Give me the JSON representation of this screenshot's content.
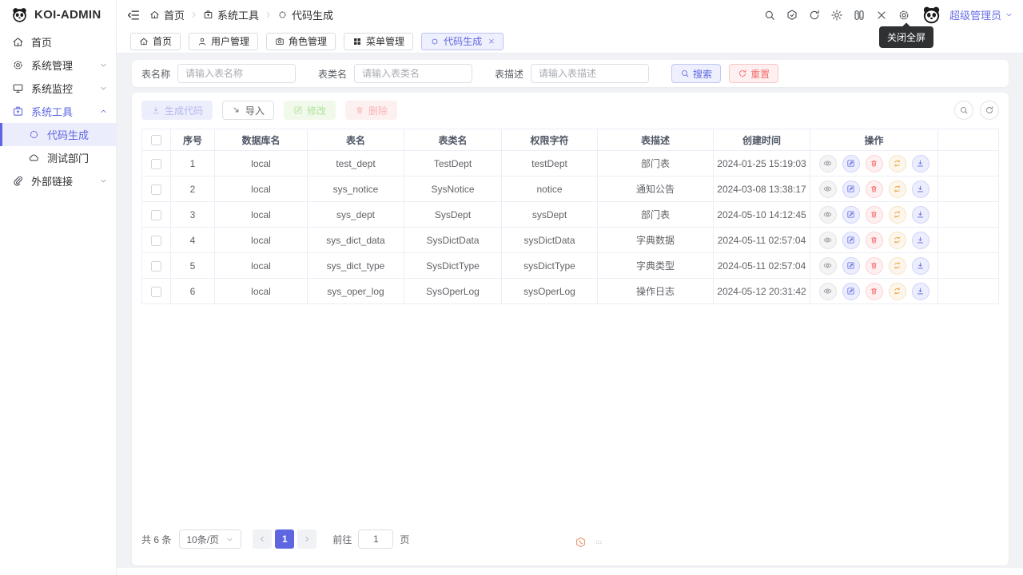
{
  "app": {
    "name": "KOI-ADMIN"
  },
  "colors": {
    "primary": "#5e66e0",
    "danger": "#f56c6c",
    "warning": "#e6a23c",
    "success": "#67c23a"
  },
  "sidebar": {
    "items": [
      {
        "key": "home",
        "icon": "home",
        "label": "首页"
      },
      {
        "key": "system-management",
        "icon": "gear",
        "label": "系统管理",
        "chevron": "down"
      },
      {
        "key": "system-monitor",
        "icon": "monitor",
        "label": "系统监控",
        "chevron": "down"
      },
      {
        "key": "system-tools",
        "icon": "toolbox",
        "label": "系统工具",
        "chevron": "up",
        "pactive": true
      },
      {
        "key": "code-generation",
        "icon": "code",
        "label": "代码生成",
        "child": true,
        "active": true
      },
      {
        "key": "test-department",
        "icon": "cloud",
        "label": "测试部门",
        "child": true
      },
      {
        "key": "external-links",
        "icon": "link",
        "label": "外部链接",
        "chevron": "down"
      }
    ]
  },
  "header": {
    "breadcrumb": [
      {
        "key": "home",
        "icon": "home",
        "label": "首页"
      },
      {
        "key": "system-tools",
        "icon": "toolbox",
        "label": "系统工具"
      },
      {
        "key": "code-generation",
        "icon": "code",
        "label": "代码生成"
      }
    ],
    "icons": [
      {
        "key": "search",
        "icon": "search"
      },
      {
        "key": "guide",
        "icon": "magic"
      },
      {
        "key": "refresh",
        "icon": "refresh"
      },
      {
        "key": "theme-toggle",
        "icon": "sun"
      },
      {
        "key": "layout-switch",
        "icon": "switch"
      },
      {
        "key": "exit-fullscreen",
        "icon": "close"
      },
      {
        "key": "settings",
        "icon": "gear"
      }
    ],
    "tooltip": "关闭全屏",
    "user": {
      "name": "超级管理员"
    }
  },
  "tabs": [
    {
      "key": "home",
      "icon": "home",
      "label": "首页"
    },
    {
      "key": "user-management",
      "icon": "user",
      "label": "用户管理"
    },
    {
      "key": "role-management",
      "icon": "camera",
      "label": "角色管理"
    },
    {
      "key": "menu-management",
      "icon": "grid",
      "label": "菜单管理"
    },
    {
      "key": "code-generation",
      "icon": "circle",
      "label": "代码生成",
      "active": true,
      "closable": true
    }
  ],
  "search": {
    "fields": [
      {
        "key": "table-name",
        "label": "表名称",
        "placeholder": "请输入表名称"
      },
      {
        "key": "table-class",
        "label": "表类名",
        "placeholder": "请输入表类名"
      },
      {
        "key": "table-desc",
        "label": "表描述",
        "placeholder": "请输入表描述"
      }
    ],
    "search_label": "搜索",
    "reset_label": "重置"
  },
  "toolbar": {
    "buttons": [
      {
        "key": "generate-code",
        "icon": "download",
        "label": "生成代码",
        "type": "primary",
        "disabled": true
      },
      {
        "key": "import",
        "icon": "import",
        "label": "导入",
        "type": "default",
        "disabled": false
      },
      {
        "key": "edit",
        "icon": "edit",
        "label": "修改",
        "type": "success",
        "disabled": true
      },
      {
        "key": "delete",
        "icon": "trash",
        "label": "删除",
        "type": "danger",
        "disabled": true
      }
    ],
    "right_icons": [
      {
        "key": "toggle-search",
        "icon": "search"
      },
      {
        "key": "refresh-table",
        "icon": "refresh"
      }
    ]
  },
  "table": {
    "columns": [
      "序号",
      "数据库名",
      "表名",
      "表类名",
      "权限字符",
      "表描述",
      "创建时间",
      "操作"
    ],
    "rows": [
      {
        "no": "1",
        "db": "local",
        "table": "test_dept",
        "class": "TestDept",
        "perm": "testDept",
        "desc": "部门表",
        "created": "2024-01-25 15:19:03"
      },
      {
        "no": "2",
        "db": "local",
        "table": "sys_notice",
        "class": "SysNotice",
        "perm": "notice",
        "desc": "通知公告",
        "created": "2024-03-08 13:38:17"
      },
      {
        "no": "3",
        "db": "local",
        "table": "sys_dept",
        "class": "SysDept",
        "perm": "sysDept",
        "desc": "部门表",
        "created": "2024-05-10 14:12:45"
      },
      {
        "no": "4",
        "db": "local",
        "table": "sys_dict_data",
        "class": "SysDictData",
        "perm": "sysDictData",
        "desc": "字典数据",
        "created": "2024-05-11 02:57:04"
      },
      {
        "no": "5",
        "db": "local",
        "table": "sys_dict_type",
        "class": "SysDictType",
        "perm": "sysDictType",
        "desc": "字典类型",
        "created": "2024-05-11 02:57:04"
      },
      {
        "no": "6",
        "db": "local",
        "table": "sys_oper_log",
        "class": "SysOperLog",
        "perm": "sysOperLog",
        "desc": "操作日志",
        "created": "2024-05-12 20:31:42"
      }
    ],
    "row_actions": [
      {
        "key": "view",
        "icon": "eye"
      },
      {
        "key": "edit",
        "icon": "edit"
      },
      {
        "key": "delete",
        "icon": "trash"
      },
      {
        "key": "sync",
        "icon": "sync"
      },
      {
        "key": "download",
        "icon": "download"
      }
    ]
  },
  "pagination": {
    "total_label": "共 6 条",
    "page_size": "10条/页",
    "current_page": "1",
    "goto_label": "前往",
    "goto_value": "1",
    "page_label": "页"
  }
}
